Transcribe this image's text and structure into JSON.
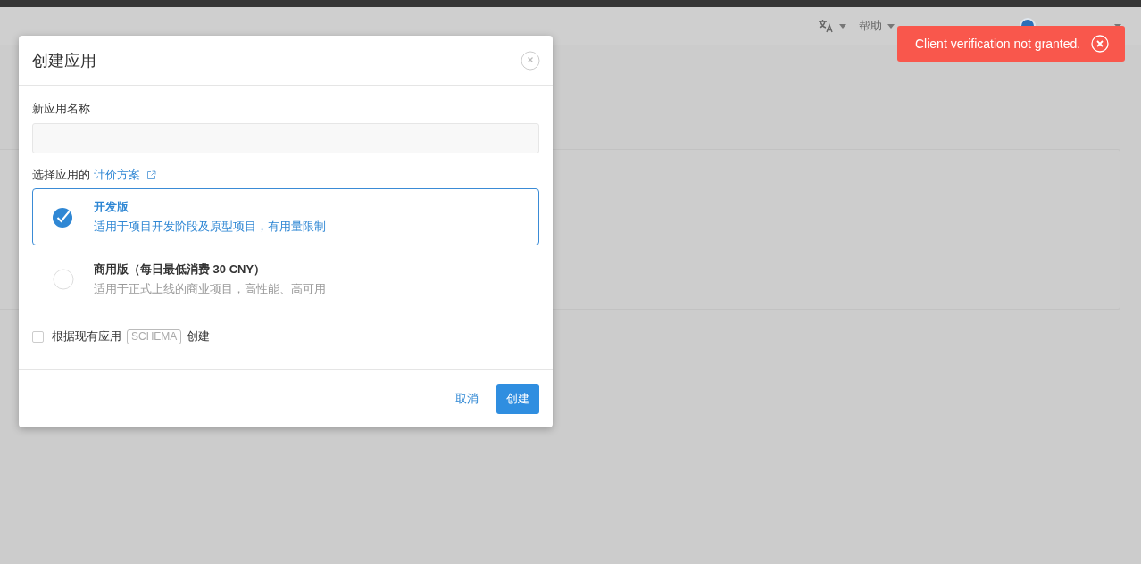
{
  "header": {
    "items": [
      {
        "kind": "translate"
      },
      {
        "kind": "menu",
        "label": "帮助"
      },
      {
        "kind": "user"
      }
    ]
  },
  "dialog": {
    "title": "创建应用",
    "name_label": "新应用名称",
    "plan_label": "选择应用的",
    "plan_link": "计价方案",
    "plans": [
      {
        "name": "开发版",
        "description": "适用于项目开发阶段及原型项目，有用量限制",
        "selected": true
      },
      {
        "name": "商用版（每日最低消费 30 CNY）",
        "description": "适用于正式上线的商业项目，高性能、高可用",
        "selected": false
      }
    ],
    "schema_option": {
      "checked": false,
      "before": "根据现有应用",
      "tag": "SCHEMA",
      "after": "创建"
    },
    "buttons": [
      {
        "kind": "link",
        "label": "取消"
      },
      {
        "kind": "primary",
        "label": "创建"
      }
    ]
  },
  "toast": {
    "message": "Client verification not granted."
  }
}
